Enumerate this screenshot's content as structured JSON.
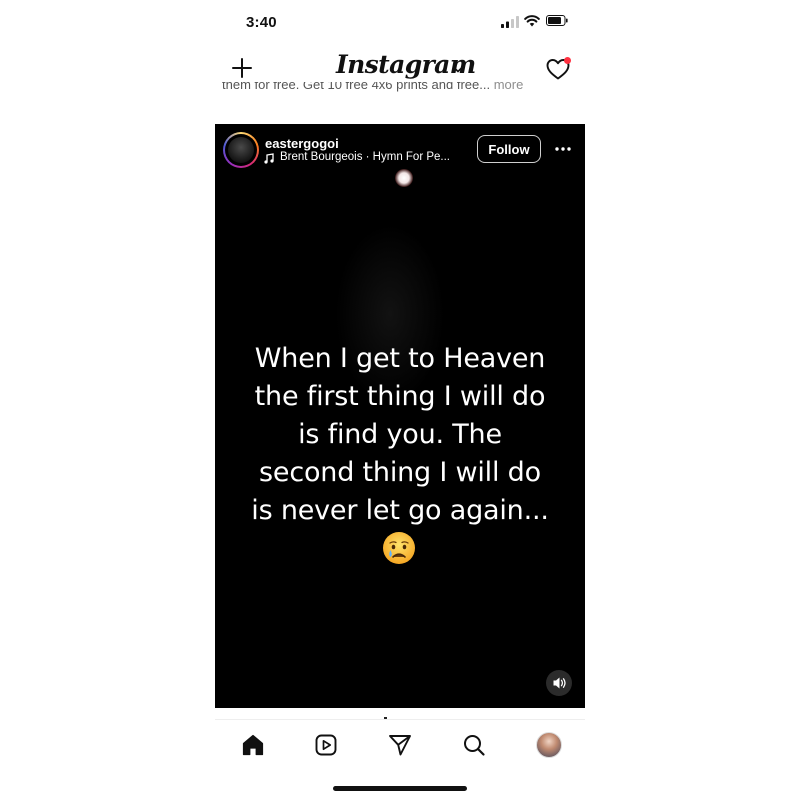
{
  "status_bar": {
    "time": "3:40"
  },
  "header": {
    "logo": "Instagram"
  },
  "caption_partial": {
    "text": "them for free. Get 10 free 4x6 prints and free...",
    "more": "more"
  },
  "post": {
    "username": "eastergogoi",
    "audio": "Brent Bourgeois · Hymn For Pe...",
    "follow_label": "Follow",
    "quote_lines": [
      "When I get to Heaven",
      "the first thing I will do",
      "is find you. The",
      "second thing I will do",
      "is never let go again..."
    ],
    "emoji": "crying-face"
  },
  "bottom_nav": {
    "items": [
      "home",
      "reels",
      "share",
      "search",
      "profile"
    ]
  },
  "colors": {
    "notification_dot": "#ff3040",
    "post_background": "#000000"
  }
}
